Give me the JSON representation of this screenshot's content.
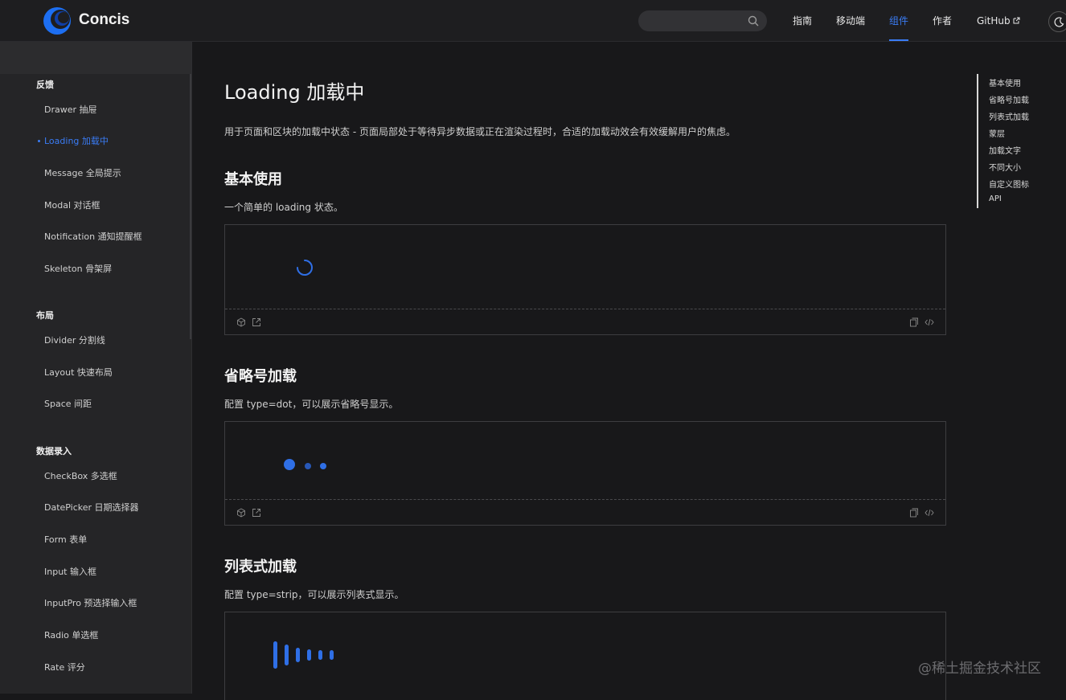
{
  "header": {
    "brand": "Concis",
    "search_placeholder": "",
    "nav": [
      {
        "label": "指南"
      },
      {
        "label": "移动端"
      },
      {
        "label": "组件",
        "active": true
      },
      {
        "label": "作者"
      },
      {
        "label": "GitHub"
      }
    ]
  },
  "sidebar": {
    "groups": [
      {
        "title": "反馈",
        "items": [
          "Drawer 抽屉",
          "Loading 加载中",
          "Message 全局提示",
          "Modal 对话框",
          "Notification 通知提醒框",
          "Skeleton 骨架屏"
        ]
      },
      {
        "title": "布局",
        "items": [
          "Divider 分割线",
          "Layout 快速布局",
          "Space 间距"
        ]
      },
      {
        "title": "数据录入",
        "items": [
          "CheckBox 多选框",
          "DatePicker 日期选择器",
          "Form 表单",
          "Input 输入框",
          "InputPro 预选择输入框",
          "Radio 单选框",
          "Rate 评分"
        ]
      }
    ],
    "active_item": "Loading 加载中"
  },
  "main": {
    "title": "Loading 加载中",
    "intro": "用于页面和区块的加载中状态 - 页面局部处于等待异步数据或正在渲染过程时，合适的加载动效会有效缓解用户的焦虑。",
    "sections": [
      {
        "title": "基本使用",
        "desc": "一个简单的 loading 状态。"
      },
      {
        "title": "省略号加载",
        "desc": "配置 type=dot，可以展示省略号显示。"
      },
      {
        "title": "列表式加载",
        "desc": "配置 type=strip，可以展示列表式显示。"
      }
    ]
  },
  "toc": [
    "基本使用",
    "省略号加载",
    "列表式加载",
    "蒙层",
    "加载文字",
    "不同大小",
    "自定义图标",
    "API"
  ],
  "watermark": "@稀土掘金技术社区",
  "colors": {
    "accent": "#3a7cf5",
    "loader": "#2f6fe6",
    "background": "#18181a",
    "sidebar": "#252527"
  }
}
